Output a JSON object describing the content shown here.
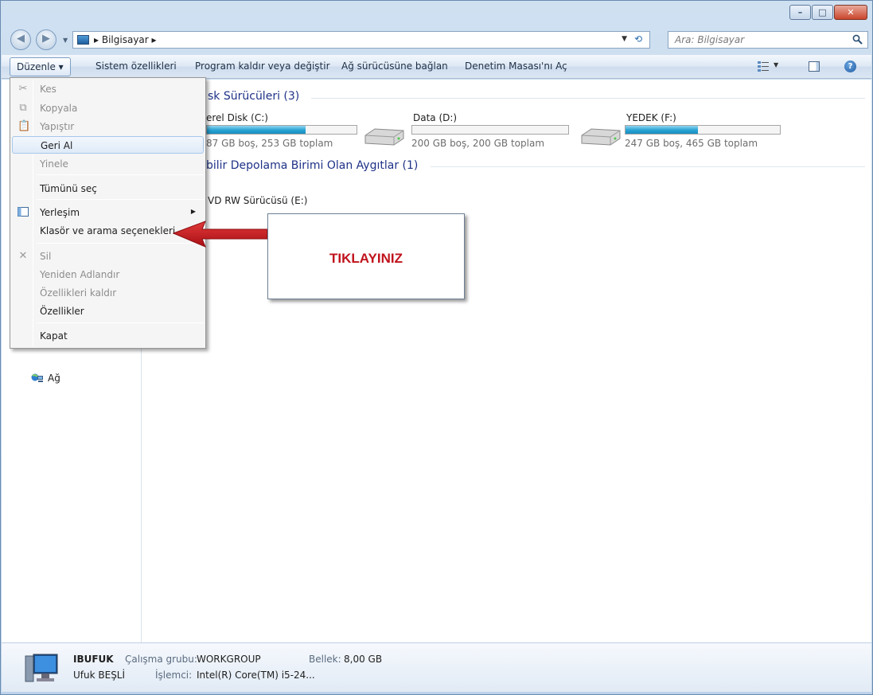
{
  "window": {
    "controls": {
      "minimize": "–",
      "maximize": "□",
      "close": "✕"
    }
  },
  "address": {
    "breadcrumb": "Bilgisayar",
    "separator": "▸",
    "search_placeholder": "Ara: Bilgisayar"
  },
  "toolbar": {
    "organize": "Düzenle ▾",
    "system_properties": "Sistem özellikleri",
    "uninstall": "Program kaldır veya değiştir",
    "map_drive": "Ağ sürücüsüne bağlan",
    "control_panel": "Denetim Masası'nı Aç"
  },
  "nav": {
    "network": "Ağ"
  },
  "groups": {
    "hard_disks": "sk Sürücüleri (3)",
    "removable": "bilir Depolama Birimi Olan Aygıtlar (1)"
  },
  "drives": [
    {
      "name": "erel Disk (C:)",
      "info": "87 GB boş, 253 GB toplam",
      "used_fraction": 0.66
    },
    {
      "name": "Data (D:)",
      "info": "200 GB boş, 200 GB toplam",
      "used_fraction": 0.0
    },
    {
      "name": "YEDEK (F:)",
      "info": "247 GB boş, 465 GB toplam",
      "used_fraction": 0.47
    }
  ],
  "removable": {
    "name": "VD RW Sürücüsü (E:)"
  },
  "menu": {
    "cut": "Kes",
    "copy": "Kopyala",
    "paste": "Yapıştır",
    "undo": "Geri Al",
    "redo": "Yinele",
    "select_all": "Tümünü seç",
    "layout": "Yerleşim",
    "folder_options": "Klasör ve arama seçenekleri",
    "delete": "Sil",
    "rename": "Yeniden Adlandır",
    "remove_properties": "Özellikleri kaldır",
    "properties": "Özellikler",
    "close": "Kapat"
  },
  "callout": {
    "text": "TIKLAYINIZ",
    "color": "#c0131c"
  },
  "details": {
    "computer_name": "IBUFUK",
    "user": "Ufuk BEŞLİ",
    "workgroup_label": "Çalışma grubu:",
    "workgroup_value": "WORKGROUP",
    "memory_label": "Bellek:",
    "memory_value": "8,00 GB",
    "cpu_label": "İşlemci:",
    "cpu_value": "Intel(R) Core(TM) i5-24..."
  }
}
